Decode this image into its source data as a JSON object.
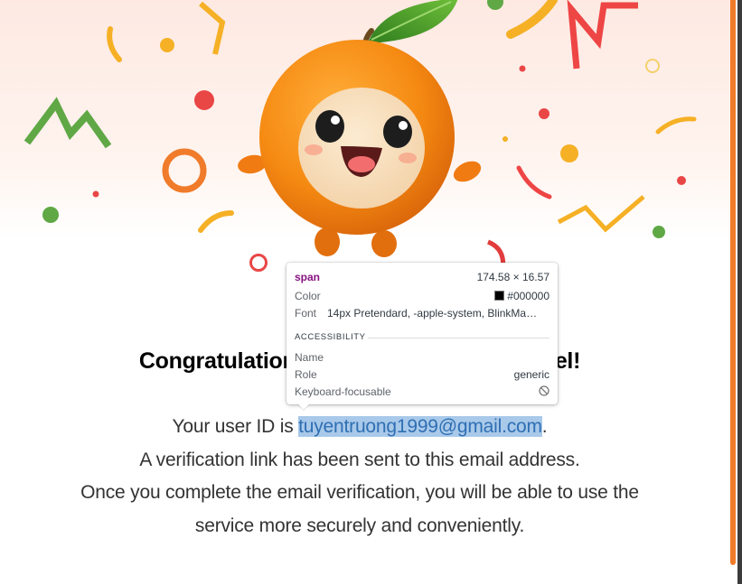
{
  "headline": {
    "start": "Congratulations",
    "end": "Hotel!"
  },
  "message": {
    "user_id_prefix": "Your user ID is ",
    "email": "tuyentruong1999@gmail.com",
    "user_id_suffix": ".",
    "line2": "A verification link has been sent to this email address.",
    "line3": "Once you complete the email verification, you will be able to use the",
    "line4": "service more securely and conveniently."
  },
  "inspector_tooltip": {
    "tag": "span",
    "size": "174.58 × 16.57",
    "color_label": "Color",
    "color_value": "#000000",
    "font_label": "Font",
    "font_value": "14px Pretendard, -apple-system, BlinkMa…",
    "section_title": "ACCESSIBILITY",
    "name_label": "Name",
    "name_value": "",
    "role_label": "Role",
    "role_value": "generic",
    "focusable_label": "Keyboard-focusable"
  },
  "theme": {
    "accent": "#f07b2a",
    "selection_bg": "#a9c9ea",
    "text_color": "#333333"
  },
  "icons": {
    "mascot": "orange-mascot-illustration",
    "not_focusable": "circle-slash-icon"
  }
}
